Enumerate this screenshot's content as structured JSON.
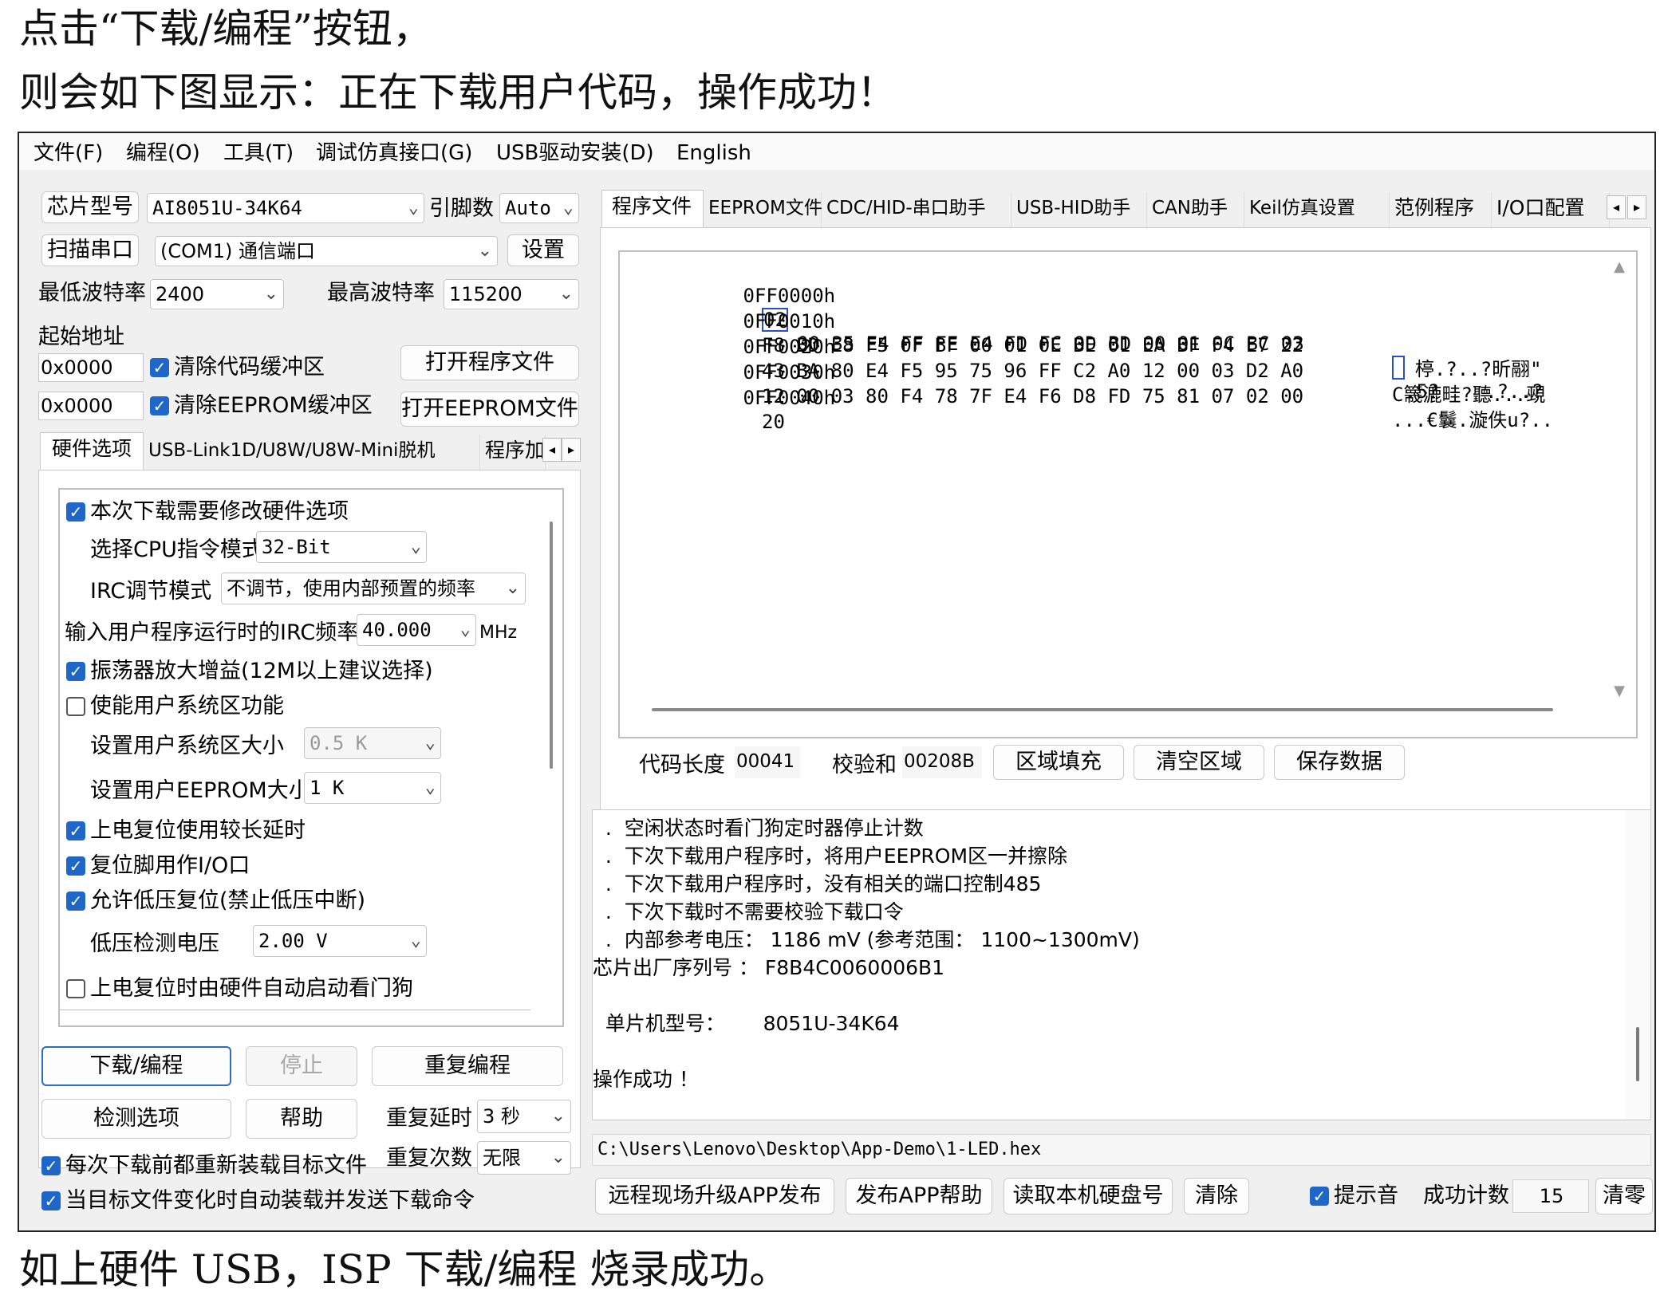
{
  "doc": {
    "line1": "点击“下载/编程”按钮，",
    "line2": "则会如下图显示：正在下载用户代码，操作成功！",
    "line3": "如上硬件 USB，ISP 下载/编程  烧录成功。"
  },
  "menu": [
    "文件(F)",
    "编程(O)",
    "工具(T)",
    "调试仿真接口(G)",
    "USB驱动安装(D)",
    "English"
  ],
  "left": {
    "chip_label": "芯片型号",
    "chip_value": "AI8051U-34K64",
    "pins_label": "引脚数",
    "pins_value": "Auto",
    "scan_label": "扫描串口",
    "port_value": "(COM1) 通信端口",
    "settings_label": "设置",
    "min_baud_label": "最低波特率",
    "min_baud_value": "2400",
    "max_baud_label": "最高波特率",
    "max_baud_value": "115200",
    "start_addr_label": "起始地址",
    "addr1": "0x0000",
    "clear_code": "清除代码缓冲区",
    "open_program": "打开程序文件",
    "addr2": "0x0000",
    "clear_eeprom": "清除EEPROM缓冲区",
    "open_eeprom": "打开EEPROM文件"
  },
  "left_tabs": [
    "硬件选项",
    "USB-Link1D/U8W/U8W-Mini脱机",
    "程序加"
  ],
  "hw": {
    "modify_hw": "本次下载需要修改硬件选项",
    "cpu_mode_label": "选择CPU指令模式",
    "cpu_mode_value": "32-Bit",
    "irc_label": "IRC调节模式",
    "irc_value": "不调节，使用内部预置的频率",
    "freq_label": "输入用户程序运行时的IRC频率",
    "freq_value": "40.000",
    "freq_unit": "MHz",
    "osc_gain": "振荡器放大增益(12M以上建议选择)",
    "user_sys": "使能用户系统区功能",
    "sys_size_label": "设置用户系统区大小",
    "sys_size_value": "0.5 K",
    "eeprom_size_label": "设置用户EEPROM大小",
    "eeprom_size_value": "1    K",
    "long_delay": "上电复位使用较长延时",
    "reset_io": "复位脚用作I/O口",
    "low_volt_reset": "允许低压复位(禁止低压中断)",
    "low_volt_label": "低压检测电压",
    "low_volt_value": "2.00 V",
    "wdt_auto": "上电复位时由硬件自动启动看门狗"
  },
  "actions": {
    "download": "下载/编程",
    "stop": "停止",
    "repeat": "重复编程",
    "detect": "检测选项",
    "help": "帮助",
    "repeat_delay_label": "重复延时",
    "repeat_delay_value": "3 秒",
    "repeat_count_label": "重复次数",
    "repeat_count_value": "无限",
    "reload_each": "每次下载前都重新装载目标文件",
    "auto_reload": "当目标文件变化时自动装载并发送下载命令"
  },
  "right_tabs": [
    "程序文件",
    "EEPROM文件",
    "CDC/HID-串口助手",
    "USB-HID助手",
    "CAN助手",
    "Keil仿真设置",
    "范例程序",
    "I/O口配置"
  ],
  "hex": {
    "rows": [
      {
        "addr": "0FF0000h",
        "bytes": [
          "02",
          "00",
          "35",
          "E4",
          "FF",
          "FE",
          "E4",
          "FD",
          "FC",
          "0D",
          "BD",
          "00",
          "01",
          "0C",
          "BC",
          "03"
        ],
        "ascii": ".5?    .?..?"
      },
      {
        "addr": "0FF0010h",
        "bytes": [
          "F8",
          "BD",
          "E8",
          "F5",
          "0F",
          "BF",
          "00",
          "01",
          "0E",
          "BE",
          "01",
          "EA",
          "BF",
          "F4",
          "E7",
          "22"
        ],
        "ascii": "  楟.?..?昕翮\""
      },
      {
        "addr": "0FF0020h",
        "bytes": [
          "43",
          "BA",
          "80",
          "E4",
          "F5",
          "95",
          "75",
          "96",
          "FF",
          "C2",
          "A0",
          "12",
          "00",
          "03",
          "D2",
          "A0"
        ],
        "ascii": "C簚漉畦?聽...覡"
      },
      {
        "addr": "0FF0030h",
        "bytes": [
          "12",
          "00",
          "03",
          "80",
          "F4",
          "78",
          "7F",
          "E4",
          "F6",
          "D8",
          "FD",
          "75",
          "81",
          "07",
          "02",
          "00"
        ],
        "ascii": "...€鬤.漩佚u?.."
      },
      {
        "addr": "0FF0040h",
        "bytes": [
          "20"
        ],
        "ascii": ""
      }
    ],
    "code_len_label": "代码长度",
    "code_len_value": "00041",
    "checksum_label": "校验和",
    "checksum_value": "00208B",
    "fill_button": "区域填充",
    "clear_area_button": "清空区域",
    "save_button": "保存数据"
  },
  "log": {
    "lines": [
      "  .  空闲状态时看门狗定时器停止计数",
      "  .  下次下载用户程序时，将用户EEPROM区一并擦除",
      "  .  下次下载用户程序时，没有相关的端口控制485",
      "  .  下次下载时不需要校验下载口令",
      "  .  内部参考电压： 1186 mV (参考范围： 1100~1300mV)",
      "芯片出厂序列号 ： F8B4C0060006B1",
      "",
      "  单片机型号：      8051U-34K64",
      "",
      "操作成功 ！"
    ],
    "file_path": "C:\\Users\\Lenovo\\Desktop\\App-Demo\\1-LED.hex"
  },
  "bottom": {
    "remote_upgrade": "远程现场升级APP发布",
    "publish_help": "发布APP帮助",
    "read_disk": "读取本机硬盘号",
    "clear": "清除",
    "beep_label": "提示音",
    "success_label": "成功计数",
    "success_value": "15",
    "reset_count": "清零"
  },
  "colors": {
    "accent": "#1e67c8",
    "window_bg": "#f0f0f0"
  }
}
